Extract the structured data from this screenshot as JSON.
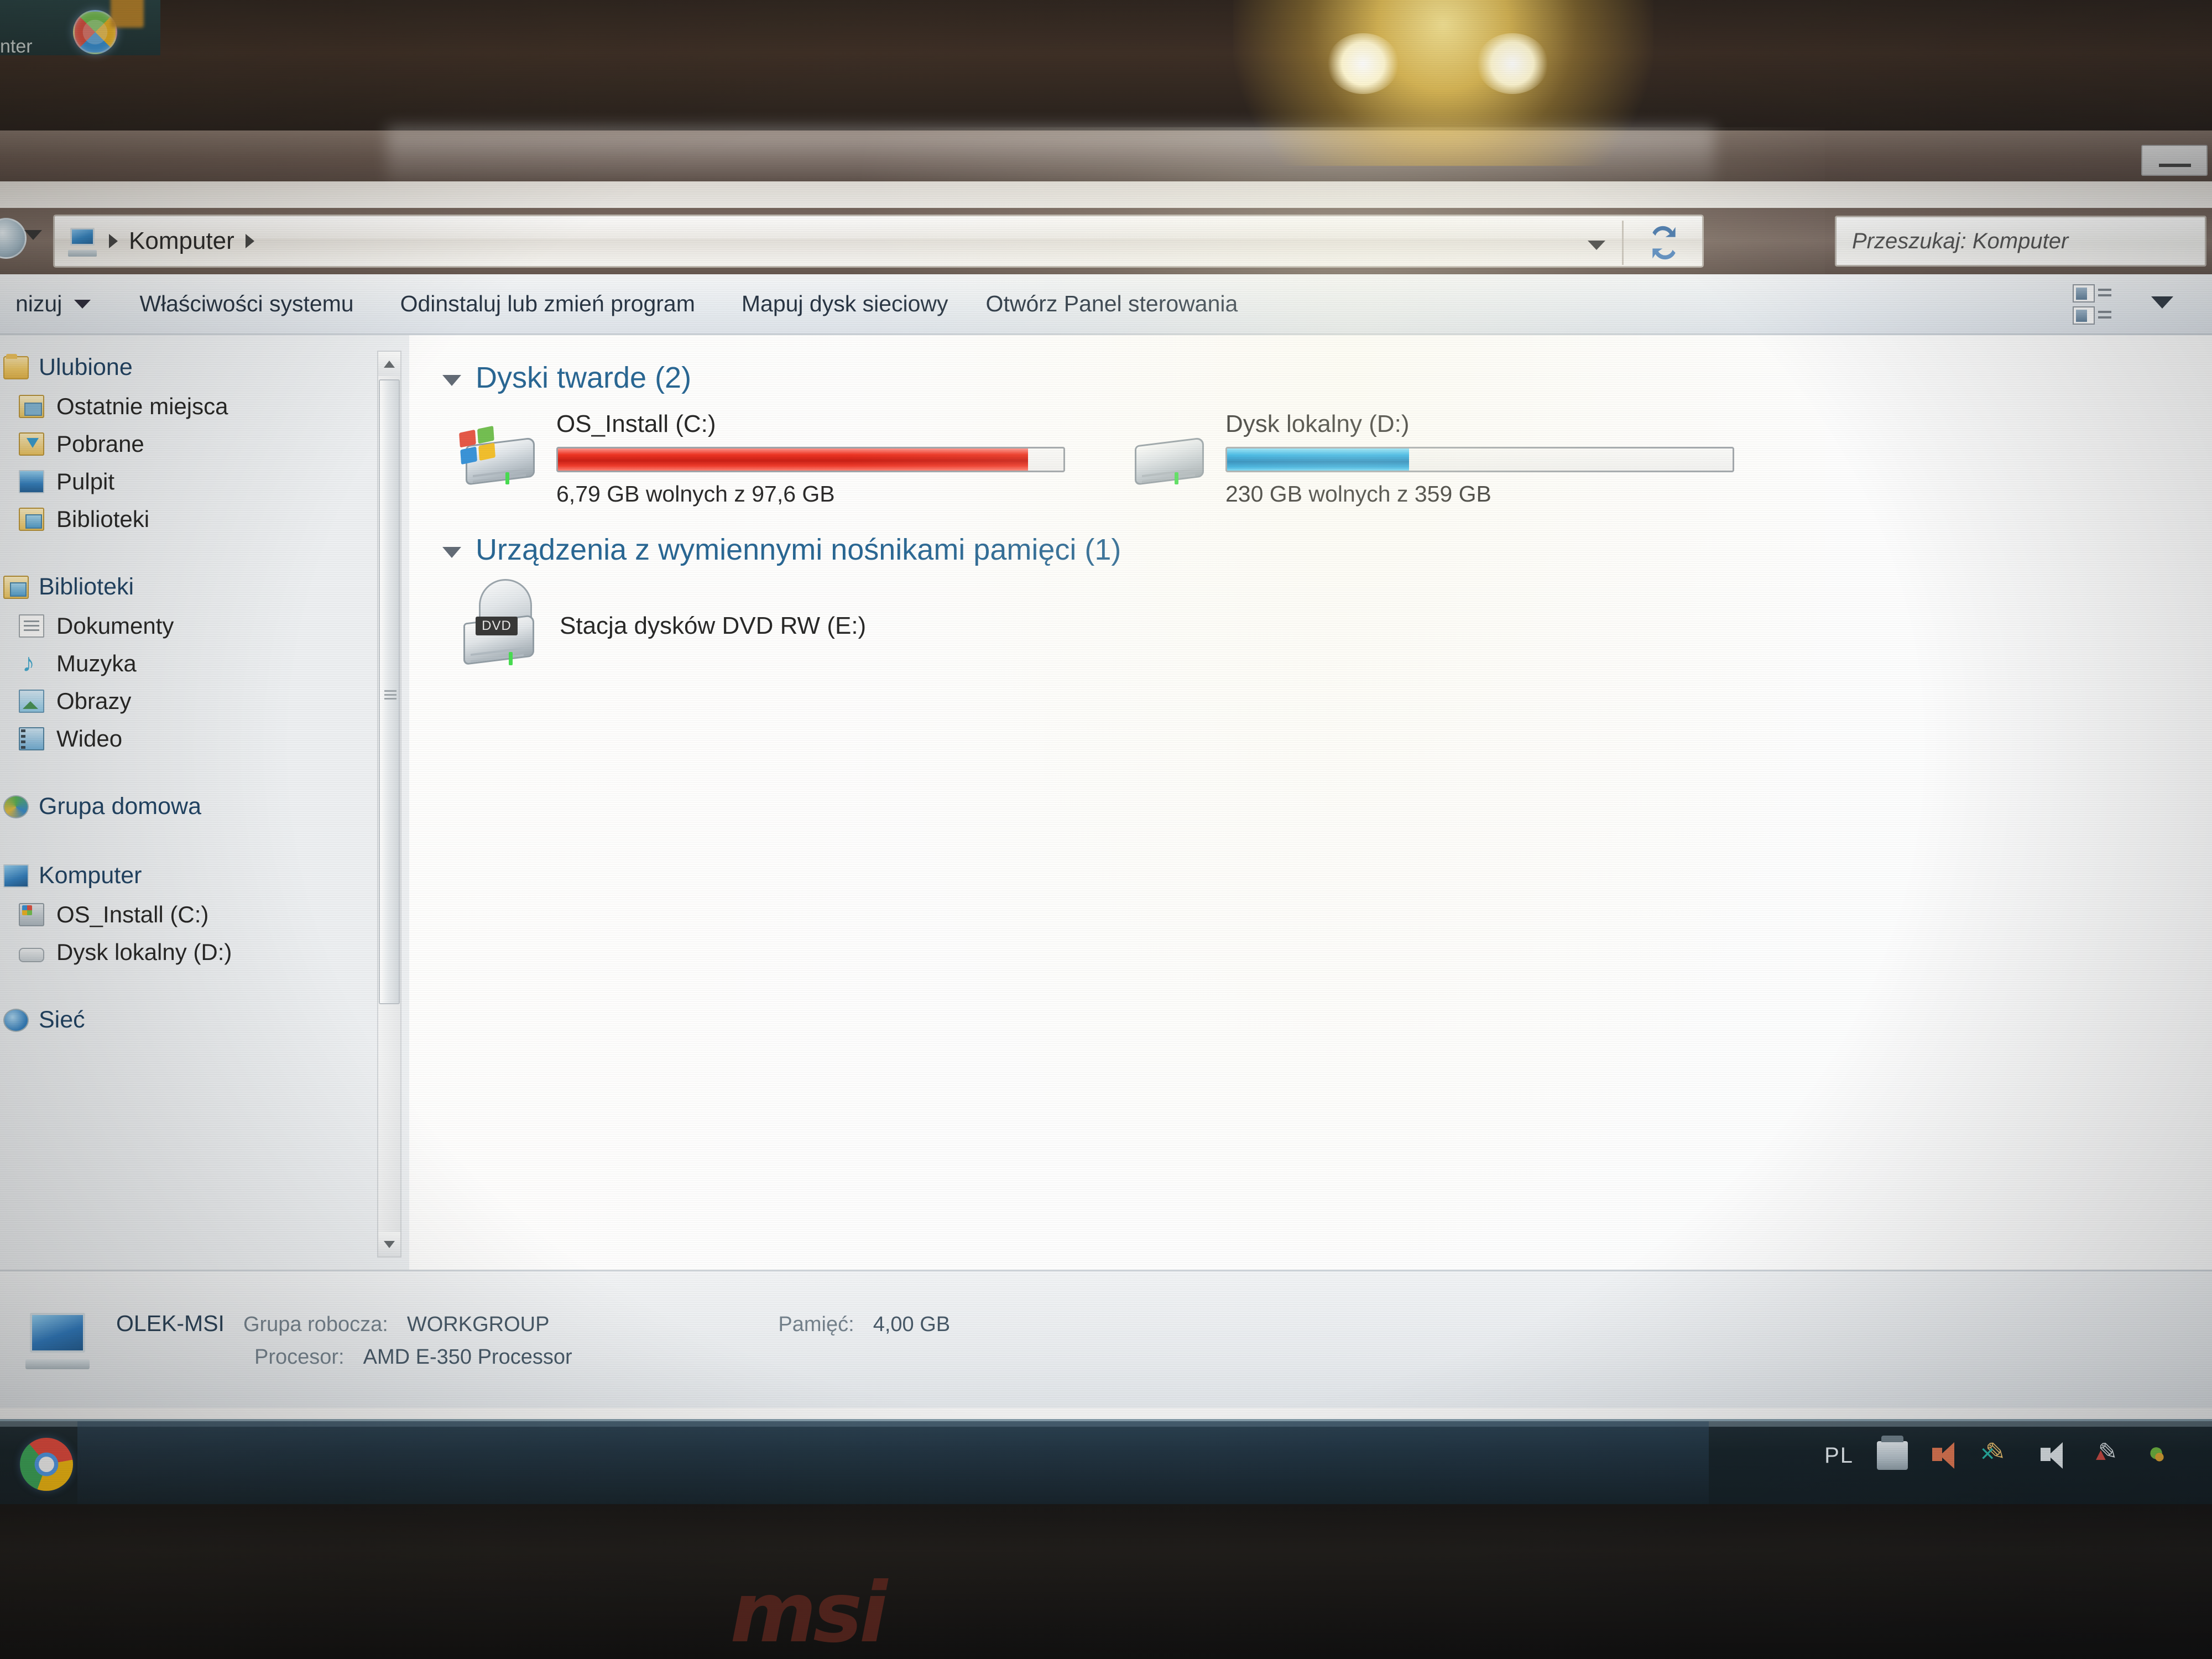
{
  "background_window": {
    "title_fragment": "nter",
    "start_orb_icon": "windows-start-orb"
  },
  "window": {
    "minimize_label": "—"
  },
  "address_bar": {
    "computer_icon": "computer-icon",
    "breadcrumb": [
      "Komputer"
    ],
    "dropdown_icon": "chevron-down-icon",
    "refresh_icon": "refresh-icon"
  },
  "search": {
    "placeholder": "Przeszukaj: Komputer",
    "icon": "search-icon"
  },
  "toolbar": {
    "organize_label": "nizuj",
    "organize_caret_icon": "chevron-down-icon",
    "items": [
      {
        "label": "Właściwości systemu"
      },
      {
        "label": "Odinstaluj lub zmień program"
      },
      {
        "label": "Mapuj dysk sieciowy"
      },
      {
        "label": "Otwórz Panel sterowania"
      }
    ],
    "view_button_icon": "view-layout-icon",
    "view_caret_icon": "chevron-down-icon"
  },
  "sidebar": {
    "groups": [
      {
        "label": "Ulubione",
        "icon": "star-icon",
        "items": [
          {
            "label": "Ostatnie miejsca",
            "icon": "recent-places-icon"
          },
          {
            "label": "Pobrane",
            "icon": "downloads-icon"
          },
          {
            "label": "Pulpit",
            "icon": "desktop-icon"
          },
          {
            "label": "Biblioteki",
            "icon": "libraries-icon"
          }
        ]
      },
      {
        "label": "Biblioteki",
        "icon": "libraries-icon",
        "items": [
          {
            "label": "Dokumenty",
            "icon": "documents-icon"
          },
          {
            "label": "Muzyka",
            "icon": "music-icon"
          },
          {
            "label": "Obrazy",
            "icon": "pictures-icon"
          },
          {
            "label": "Wideo",
            "icon": "video-icon"
          }
        ]
      },
      {
        "label": "Grupa domowa",
        "icon": "homegroup-icon",
        "items": []
      },
      {
        "label": "Komputer",
        "icon": "computer-icon",
        "items": [
          {
            "label": "OS_Install (C:)",
            "icon": "system-drive-icon"
          },
          {
            "label": "Dysk lokalny (D:)",
            "icon": "drive-icon"
          }
        ]
      },
      {
        "label": "Sieć",
        "icon": "network-icon",
        "items": []
      }
    ],
    "scrollbar": {
      "up_icon": "scroll-up-icon",
      "down_icon": "scroll-down-icon"
    }
  },
  "content": {
    "groups": [
      {
        "title": "Dyski twarde (2)",
        "collapse_icon": "triangle-collapse-icon",
        "drives": [
          {
            "name": "OS_Install (C:)",
            "free_text": "6,79 GB wolnych z 97,6 GB",
            "free_gb": 6.79,
            "total_gb": 97.6,
            "used_percent": 93,
            "bar_color": "#d0170b",
            "icon": "system-hard-drive-icon"
          },
          {
            "name": "Dysk lokalny (D:)",
            "free_text": "230 GB wolnych z 359 GB",
            "free_gb": 230,
            "total_gb": 359,
            "used_percent": 36,
            "bar_color": "#0f9ddd",
            "icon": "hard-drive-icon"
          }
        ]
      },
      {
        "title": "Urządzenia z wymiennymi nośnikami pamięci (1)",
        "collapse_icon": "triangle-collapse-icon",
        "devices": [
          {
            "name": "Stacja dysków DVD RW (E:)",
            "badge": "DVD",
            "icon": "dvd-drive-icon"
          }
        ]
      }
    ]
  },
  "status_bar": {
    "computer_icon": "computer-icon",
    "computer_name": "OLEK-MSI",
    "workgroup_label": "Grupa robocza:",
    "workgroup_value": "WORKGROUP",
    "memory_label": "Pamięć:",
    "memory_value": "4,00 GB",
    "processor_label": "Procesor:",
    "processor_value": "AMD E-350 Processor"
  },
  "taskbar": {
    "chrome_icon": "google-chrome-icon",
    "tray": {
      "language": "PL",
      "icons": [
        "display-icon",
        "speaker-orange-icon",
        "network-config-icon",
        "volume-icon",
        "shield-warning-icon",
        "status-dots-icon"
      ]
    }
  },
  "device_brand": "msi"
}
